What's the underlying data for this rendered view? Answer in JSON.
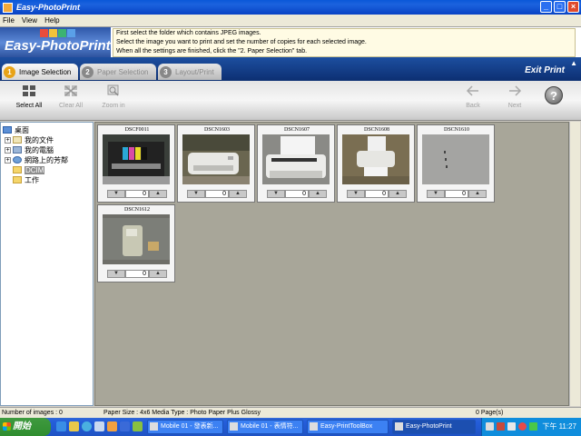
{
  "window": {
    "title": "Easy-PhotoPrint",
    "controls": [
      "_",
      "□",
      "×"
    ]
  },
  "menu": [
    "File",
    "View",
    "Help"
  ],
  "header": {
    "logo": "Easy-PhotoPrint",
    "instructions": [
      "First select the folder which contains JPEG images.",
      "Select the image you want to print and set the number of copies for each selected image.",
      "When all the settings are finished, click the \"2. Paper Selection\" tab."
    ]
  },
  "tabs": [
    {
      "num": "1",
      "label": "Image Selection",
      "active": true
    },
    {
      "num": "2",
      "label": "Paper Selection",
      "active": false
    },
    {
      "num": "3",
      "label": "Layout/Print",
      "active": false
    }
  ],
  "exit_label": "Exit Print",
  "toolbar": {
    "select_all": "Select All",
    "clear_all": "Clear All",
    "zoom_in": "Zoom in",
    "back": "Back",
    "next": "Next",
    "help": "?"
  },
  "tree": [
    {
      "label": "桌面",
      "icon": "desktop-icon"
    },
    {
      "label": "我的文件",
      "icon": "documents-icon"
    },
    {
      "label": "我的電腦",
      "icon": "computer-icon"
    },
    {
      "label": "網路上的芳鄰",
      "icon": "network-icon"
    },
    {
      "label": "DCIM",
      "icon": "folder-icon"
    },
    {
      "label": "工作",
      "icon": "folder-icon"
    }
  ],
  "images": [
    {
      "name": "DSCF0011",
      "copies": "0"
    },
    {
      "name": "DSCN1603",
      "copies": "0"
    },
    {
      "name": "DSCN1607",
      "copies": "0"
    },
    {
      "name": "DSCN1608",
      "copies": "0"
    },
    {
      "name": "DSCN1610",
      "copies": "0"
    },
    {
      "name": "DSCN1612",
      "copies": "0"
    }
  ],
  "status": {
    "count": "Number of images : 0",
    "paper": "Paper Size : 4x6  Media Type : Photo Paper Plus Glossy",
    "pages": "0 Page(s)"
  },
  "taskbar": {
    "start": "開始",
    "tasks": [
      "Mobile 01 - 發表新...",
      "Mobile 01 - 表情符...",
      "Easy-PrintToolBox",
      "Easy-PhotoPrint"
    ],
    "clock": "下午 11:27"
  }
}
